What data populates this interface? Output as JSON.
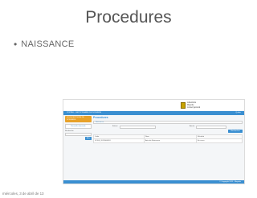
{
  "slide": {
    "title": "Procedures",
    "bullet": "NAISSANCE",
    "footer_date": "miércoles, 3 de abril de 13"
  },
  "app": {
    "logo_lines": [
      "collectivité",
      "Mayotte",
      "conseil général"
    ],
    "nav_left": "PORTAIL - GESTIONNAIRE DE DOSSIERS",
    "nav_right": "Quitter",
    "sidebar": {
      "active_item": "SOUSCRIPTIONS DE DOSSIERS",
      "item": "Nouvelle demande",
      "search_label": "Recherche",
      "button": "Aller"
    },
    "main": {
      "title": "Procedures",
      "section": "Naissance",
      "field_a_label": "Enfant",
      "field_b_label": "Année",
      "action_button": "Rechercher",
      "columns": [
        "Code",
        "Nom",
        "Résultat"
      ],
      "rows": [
        [
          "DOSS_2013000018",
          "Acte de Naissance",
          "En cours"
        ]
      ]
    },
    "footer_text": "© Copyright 2013 - Mayotte"
  },
  "colors": {
    "accent": "#3a8fd1",
    "active": "#e8a22a"
  }
}
